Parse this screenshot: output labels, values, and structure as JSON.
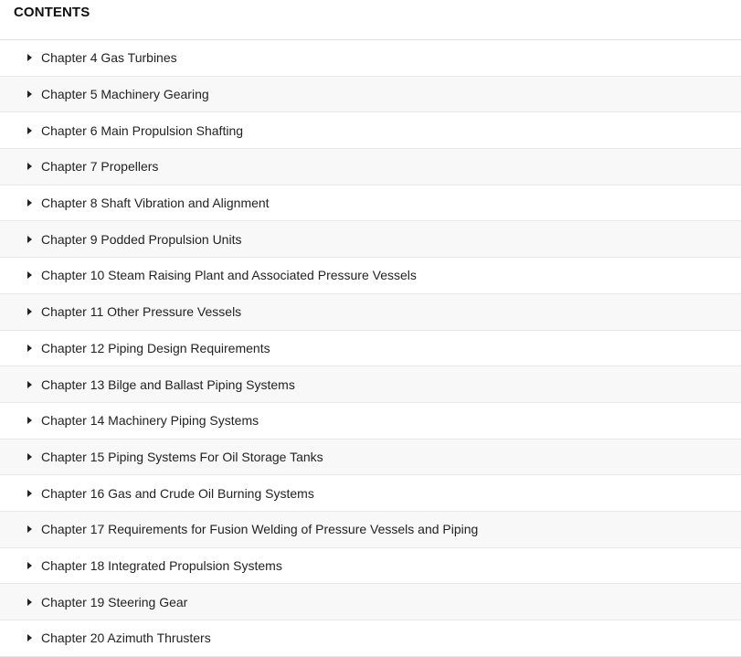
{
  "contents": {
    "title": "CONTENTS",
    "icon": "caret-right-icon",
    "chapters": [
      {
        "label": "Chapter 4 Gas Turbines"
      },
      {
        "label": "Chapter 5 Machinery Gearing"
      },
      {
        "label": "Chapter 6 Main Propulsion Shafting"
      },
      {
        "label": "Chapter 7 Propellers"
      },
      {
        "label": "Chapter 8 Shaft Vibration and Alignment"
      },
      {
        "label": "Chapter 9 Podded Propulsion Units"
      },
      {
        "label": "Chapter 10 Steam Raising Plant and Associated Pressure Vessels"
      },
      {
        "label": "Chapter 11 Other Pressure Vessels"
      },
      {
        "label": "Chapter 12 Piping Design Requirements"
      },
      {
        "label": "Chapter 13 Bilge and Ballast Piping Systems"
      },
      {
        "label": "Chapter 14 Machinery Piping Systems"
      },
      {
        "label": "Chapter 15 Piping Systems For Oil Storage Tanks"
      },
      {
        "label": "Chapter 16 Gas and Crude Oil Burning Systems"
      },
      {
        "label": "Chapter 17 Requirements for Fusion Welding of Pressure Vessels and Piping"
      },
      {
        "label": "Chapter 18 Integrated Propulsion Systems"
      },
      {
        "label": "Chapter 19 Steering Gear"
      },
      {
        "label": "Chapter 20 Azimuth Thrusters"
      }
    ]
  }
}
